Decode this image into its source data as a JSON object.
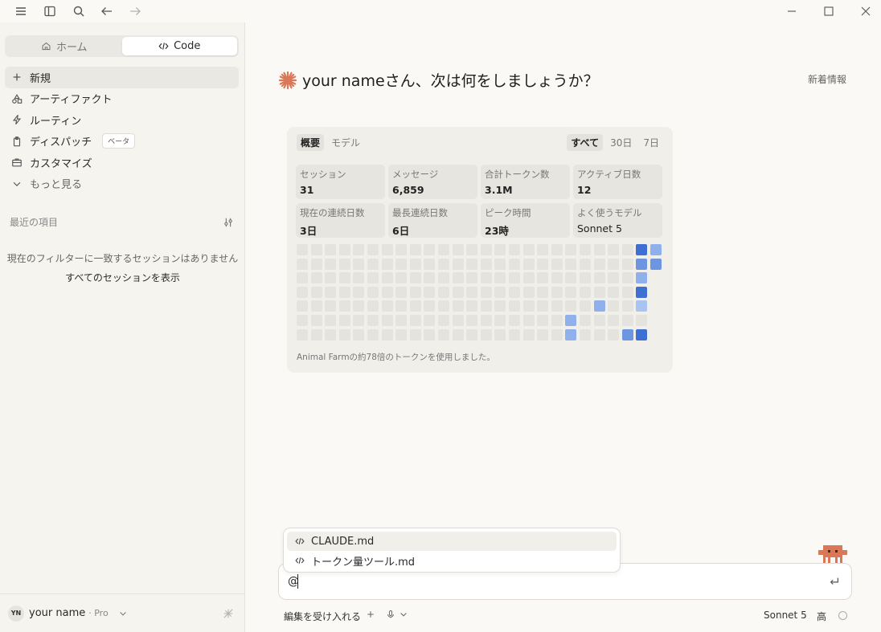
{
  "sidebar": {
    "home_label": "ホーム",
    "code_label": "Code",
    "items": [
      {
        "label": "新規",
        "icon": "plus-icon"
      },
      {
        "label": "アーティファクト",
        "icon": "shapes-icon"
      },
      {
        "label": "ルーティン",
        "icon": "bolt-icon"
      },
      {
        "label": "ディスパッチ",
        "icon": "clipboard-icon",
        "badge": "ベータ"
      },
      {
        "label": "カスタマイズ",
        "icon": "briefcase-icon"
      },
      {
        "label": "もっと見る",
        "icon": "chevron-down-icon"
      }
    ],
    "recent_title": "最近の項目",
    "empty_message": "現在のフィルターに一致するセッションはありません",
    "show_all": "すべてのセッションを表示",
    "user": {
      "initials": "YN",
      "name": "your name",
      "plan": "· Pro"
    }
  },
  "main": {
    "greeting": "your nameさん、次は何をしましょうか？",
    "news": "新着情報"
  },
  "stats": {
    "tabs": [
      "概要",
      "モデル"
    ],
    "ranges": [
      "すべて",
      "30日",
      "7日"
    ],
    "cards": [
      {
        "label": "セッション",
        "value": "31"
      },
      {
        "label": "メッセージ",
        "value": "6,859"
      },
      {
        "label": "合計トークン数",
        "value": "3.1M"
      },
      {
        "label": "アクティブ日数",
        "value": "12"
      },
      {
        "label": "現在の連続日数",
        "value": "3日"
      },
      {
        "label": "最長連続日数",
        "value": "6日"
      },
      {
        "label": "ピーク時間",
        "value": "23時"
      },
      {
        "label": "よく使うモデル",
        "value": "Sonnet 5"
      }
    ],
    "note": "Animal Farmの約78倍のトークンを使用しました。",
    "heatmap": {
      "rows": 7,
      "cols": 26,
      "colors": {
        "empty": "#e4e3dd",
        "level1": "#a9c4f0",
        "level2": "#8fb0ea",
        "level3": "#6d95e0",
        "level4": "#3f6fd3"
      },
      "active": [
        {
          "row": 0,
          "col": 24,
          "level": 4
        },
        {
          "row": 0,
          "col": 25,
          "level": 2
        },
        {
          "row": 1,
          "col": 24,
          "level": 3
        },
        {
          "row": 1,
          "col": 25,
          "level": 3
        },
        {
          "row": 2,
          "col": 24,
          "level": 2
        },
        {
          "row": 3,
          "col": 24,
          "level": 4
        },
        {
          "row": 4,
          "col": 21,
          "level": 2
        },
        {
          "row": 4,
          "col": 24,
          "level": 1
        },
        {
          "row": 5,
          "col": 19,
          "level": 2
        },
        {
          "row": 6,
          "col": 19,
          "level": 2
        },
        {
          "row": 6,
          "col": 23,
          "level": 3
        },
        {
          "row": 6,
          "col": 24,
          "level": 4
        }
      ],
      "hidden": [
        {
          "row": 2,
          "col": 25
        },
        {
          "row": 3,
          "col": 25
        },
        {
          "row": 4,
          "col": 25
        },
        {
          "row": 5,
          "col": 25
        },
        {
          "row": 6,
          "col": 25
        }
      ]
    }
  },
  "popup": {
    "items": [
      "CLAUDE.md",
      "トークン量ツール.md"
    ]
  },
  "input": {
    "value": "@"
  },
  "footer": {
    "accept_edits": "編集を受け入れる",
    "model": "Sonnet 5",
    "effort": "高"
  }
}
